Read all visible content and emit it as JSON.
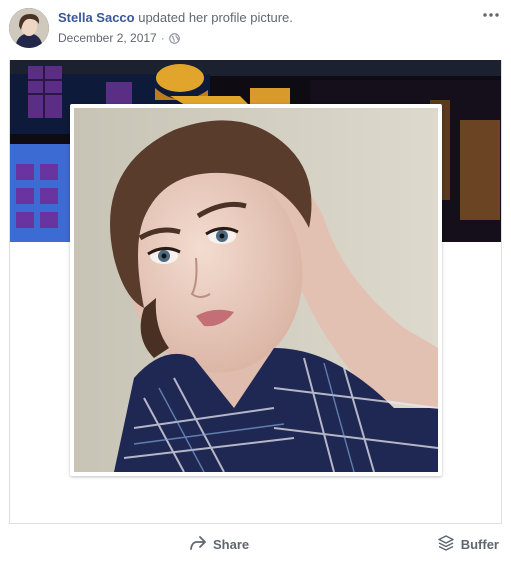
{
  "post": {
    "author": "Stella Sacco",
    "action": " updated her profile picture.",
    "date": "December 2, 2017",
    "separator": "·",
    "audience_icon": "globe-icon",
    "menu_icon": "more-options-icon"
  },
  "actions": {
    "share_label": "Share",
    "share_icon": "share-arrow-icon",
    "buffer_label": "Buffer",
    "buffer_icon": "buffer-stack-icon"
  },
  "colors": {
    "author_link": "#385898",
    "secondary_text": "#606770",
    "border": "#dddfe2"
  }
}
